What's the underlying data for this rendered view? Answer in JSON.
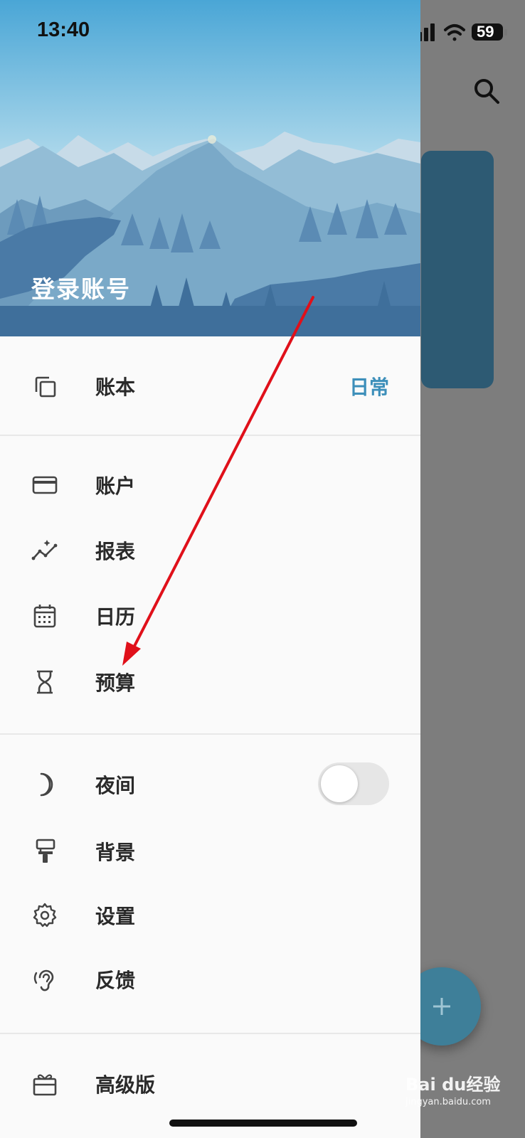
{
  "status_bar": {
    "time": "13:40",
    "battery": "59"
  },
  "header": {
    "login_label": "登录账号"
  },
  "menu": {
    "book": {
      "label": "账本",
      "value": "日常"
    },
    "group1": [
      {
        "label": "账户",
        "icon": "card-icon"
      },
      {
        "label": "报表",
        "icon": "chart-icon"
      },
      {
        "label": "日历",
        "icon": "calendar-icon"
      },
      {
        "label": "预算",
        "icon": "hourglass-icon"
      }
    ],
    "night": {
      "label": "夜间",
      "enabled": false
    },
    "group2": [
      {
        "label": "背景",
        "icon": "paint-roller-icon"
      },
      {
        "label": "设置",
        "icon": "gear-icon"
      },
      {
        "label": "反馈",
        "icon": "ear-icon"
      }
    ],
    "premium": {
      "label": "高级版"
    }
  },
  "watermark": {
    "brand": "Bai du经验",
    "url": "jingyan.baidu.com"
  },
  "colors": {
    "accent": "#3d8fba",
    "fab": "#3e7f99",
    "card": "#2d5a73",
    "arrow": "#e0101a"
  }
}
